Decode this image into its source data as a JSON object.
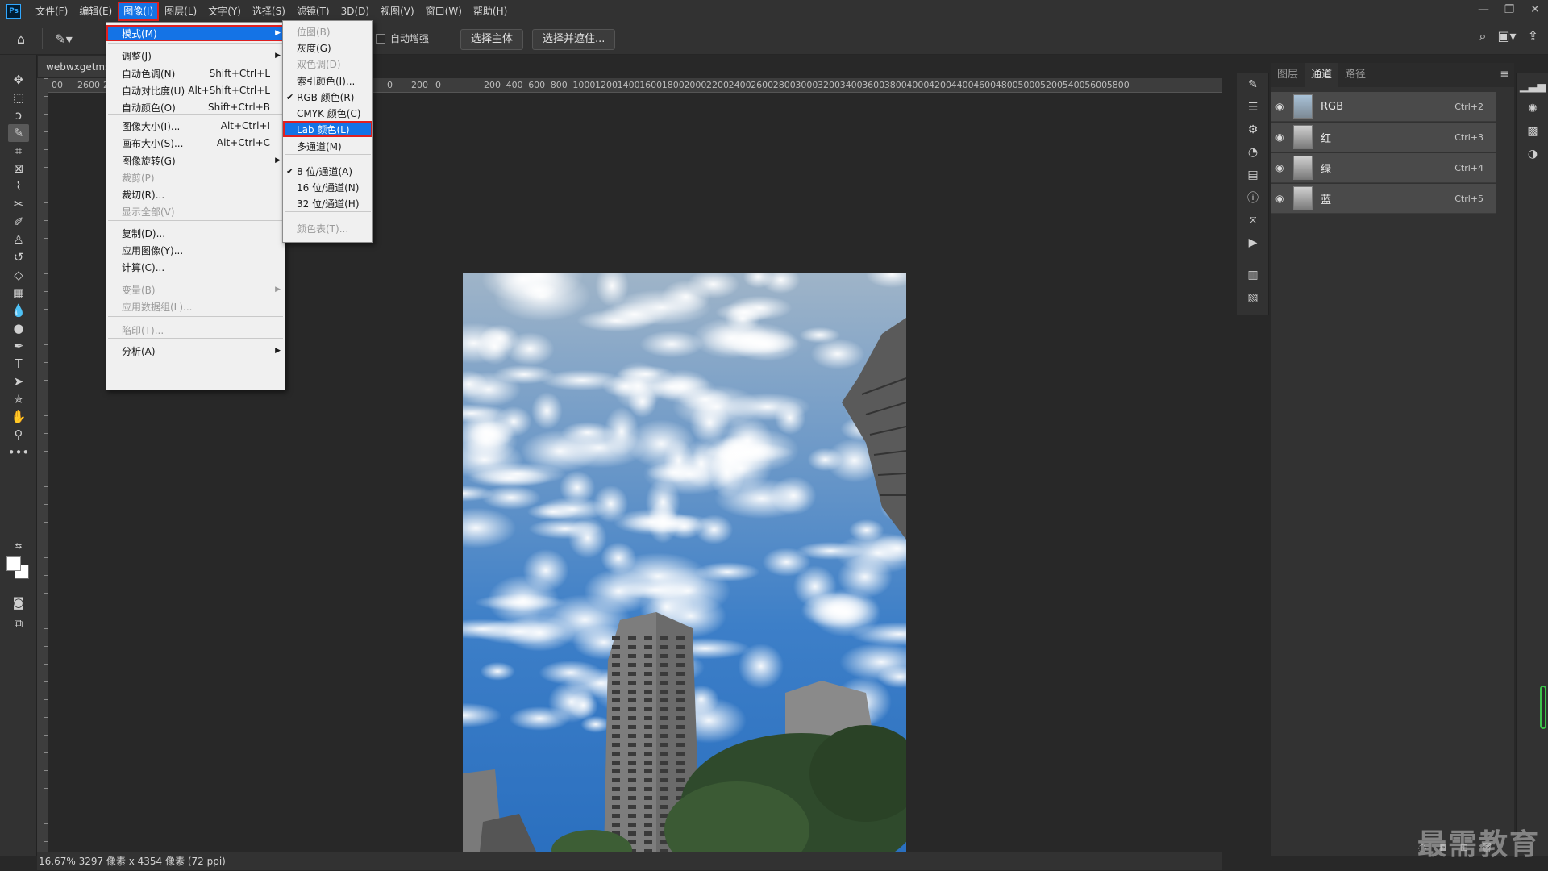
{
  "app": {
    "logo": "Ps"
  },
  "menubar": {
    "items": [
      "文件(F)",
      "编辑(E)",
      "图像(I)",
      "图层(L)",
      "文字(Y)",
      "选择(S)",
      "滤镜(T)",
      "3D(D)",
      "视图(V)",
      "窗口(W)",
      "帮助(H)"
    ],
    "active_index": 2
  },
  "options_bar": {
    "auto_enhance": "自动增强",
    "select_subject": "选择主体",
    "select_and_mask": "选择并遮住..."
  },
  "document": {
    "tab_title": "webwxgetms",
    "status": "16.67%   3297 像素 x 4354 像素 (72 ppi)",
    "ruler_labels": [
      "00",
      "2600",
      "24",
      "0",
      "200",
      "0",
      "200",
      "400",
      "600",
      "800",
      "1000",
      "1200",
      "1400",
      "1600",
      "1800",
      "2000",
      "2200",
      "2400",
      "2600",
      "2800",
      "3000",
      "3200",
      "3400",
      "3600",
      "3800",
      "4000",
      "4200",
      "4400",
      "4600",
      "4800",
      "5000",
      "5200",
      "5400",
      "5600",
      "5800"
    ]
  },
  "image_menu": {
    "items": [
      {
        "label": "模式(M)",
        "shortcut": "",
        "submenu": true,
        "highlight": true
      },
      {
        "label": "调整(J)",
        "shortcut": "",
        "submenu": true
      },
      {
        "label": "自动色调(N)",
        "shortcut": "Shift+Ctrl+L"
      },
      {
        "label": "自动对比度(U)",
        "shortcut": "Alt+Shift+Ctrl+L"
      },
      {
        "label": "自动颜色(O)",
        "shortcut": "Shift+Ctrl+B"
      },
      {
        "label": "图像大小(I)...",
        "shortcut": "Alt+Ctrl+I"
      },
      {
        "label": "画布大小(S)...",
        "shortcut": "Alt+Ctrl+C"
      },
      {
        "label": "图像旋转(G)",
        "shortcut": "",
        "submenu": true
      },
      {
        "label": "裁剪(P)",
        "shortcut": "",
        "disabled": true
      },
      {
        "label": "裁切(R)...",
        "shortcut": ""
      },
      {
        "label": "显示全部(V)",
        "shortcut": "",
        "disabled": true
      },
      {
        "label": "复制(D)...",
        "shortcut": ""
      },
      {
        "label": "应用图像(Y)...",
        "shortcut": ""
      },
      {
        "label": "计算(C)...",
        "shortcut": ""
      },
      {
        "label": "变量(B)",
        "shortcut": "",
        "submenu": true,
        "disabled": true
      },
      {
        "label": "应用数据组(L)...",
        "shortcut": "",
        "disabled": true
      },
      {
        "label": "陷印(T)...",
        "shortcut": "",
        "disabled": true
      },
      {
        "label": "分析(A)",
        "shortcut": "",
        "submenu": true
      }
    ]
  },
  "mode_menu": {
    "items": [
      {
        "label": "位图(B)",
        "disabled": true
      },
      {
        "label": "灰度(G)"
      },
      {
        "label": "双色调(D)",
        "disabled": true
      },
      {
        "label": "索引颜色(I)..."
      },
      {
        "label": "RGB 颜色(R)",
        "checked": true
      },
      {
        "label": "CMYK 颜色(C)"
      },
      {
        "label": "Lab 颜色(L)",
        "highlight": true
      },
      {
        "label": "多通道(M)"
      },
      {
        "label": "8 位/通道(A)",
        "checked": true
      },
      {
        "label": "16 位/通道(N)"
      },
      {
        "label": "32 位/通道(H)"
      },
      {
        "label": "颜色表(T)...",
        "disabled": true
      }
    ]
  },
  "panel": {
    "tabs": [
      "图层",
      "通道",
      "路径"
    ],
    "active_tab": 1,
    "channels": [
      {
        "name": "RGB",
        "shortcut": "Ctrl+2"
      },
      {
        "name": "红",
        "shortcut": "Ctrl+3"
      },
      {
        "name": "绿",
        "shortcut": "Ctrl+4"
      },
      {
        "name": "蓝",
        "shortcut": "Ctrl+5"
      }
    ]
  },
  "watermark": "最需教育",
  "colors": {
    "accent": "#1473e6",
    "highlight_border": "#e02020",
    "chrome": "#323232",
    "canvas": "#282828"
  }
}
